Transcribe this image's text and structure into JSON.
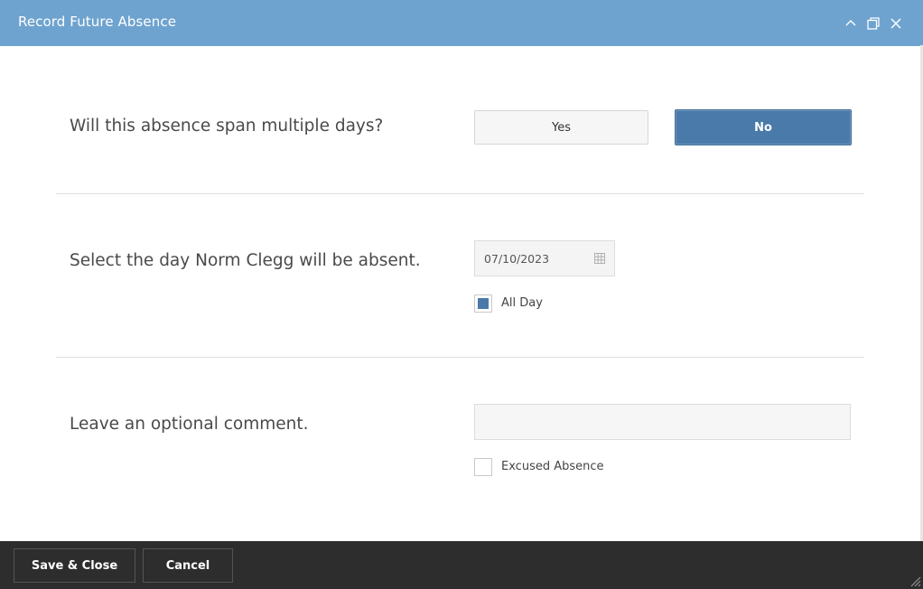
{
  "window": {
    "title": "Record Future Absence",
    "controls": [
      "chevron-up-icon",
      "restore-icon",
      "close-icon"
    ],
    "header_color": "#6fa3cf"
  },
  "multi_day": {
    "question": "Will this absence span multiple days?",
    "yes_label": "Yes",
    "no_label": "No",
    "selected": "No",
    "selected_color": "#4a7aa9"
  },
  "day": {
    "question": "Select the day Norm Clegg will be absent.",
    "date_value": "07/10/2023",
    "all_day_label": "All Day",
    "all_day_checked": true
  },
  "comment": {
    "question": "Leave an optional comment.",
    "value": "",
    "placeholder": "",
    "excused_label": "Excused Absence",
    "excused_checked": false
  },
  "footer": {
    "save_label": "Save & Close",
    "cancel_label": "Cancel",
    "background": "#2d2d2d"
  }
}
